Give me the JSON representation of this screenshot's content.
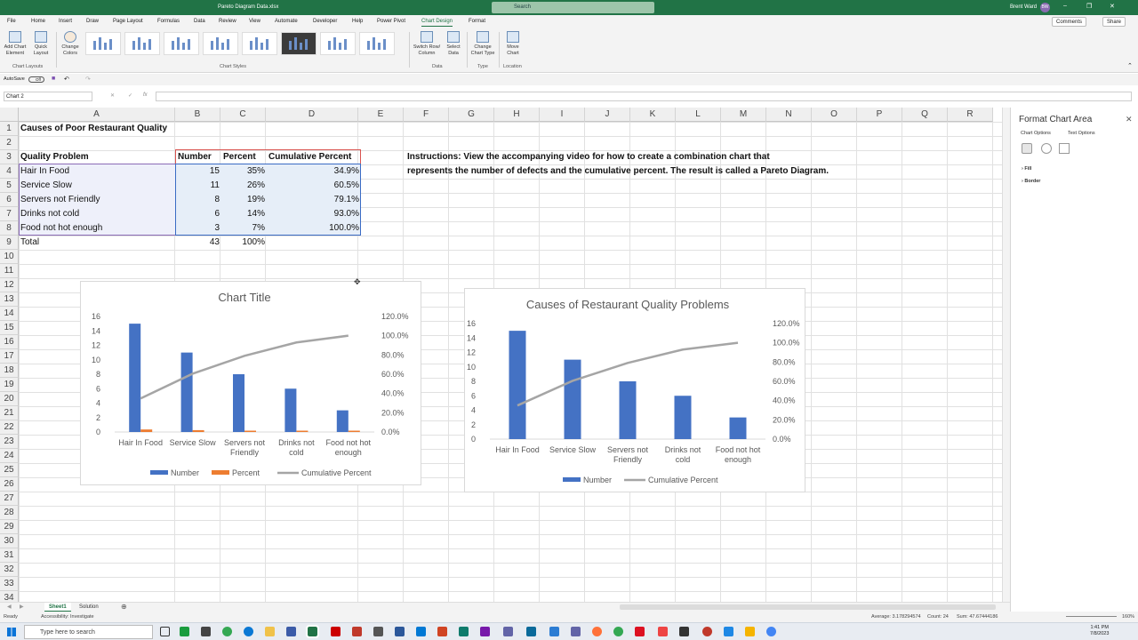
{
  "titlebar": {
    "file_title": "Pareto Diagram Data.xlsx",
    "search_placeholder": "Search",
    "user_name": "Brent Ward",
    "user_initials": "BW"
  },
  "menu_tabs": [
    "File",
    "Home",
    "Insert",
    "Draw",
    "Page Layout",
    "Formulas",
    "Data",
    "Review",
    "View",
    "Automate",
    "Developer",
    "Help",
    "Power Pivot",
    "Chart Design",
    "Format"
  ],
  "active_tab": "Chart Design",
  "comments_label": "Comments",
  "share_label": "Share",
  "ribbon": {
    "add_chart_element": "Add Chart Element",
    "quick_layout": "Quick Layout",
    "change_colors": "Change Colors",
    "switch_row_column": "Switch Row/ Column",
    "select_data": "Select Data",
    "change_chart_type": "Change Chart Type",
    "move_chart": "Move Chart",
    "groups": {
      "chart_layouts": "Chart Layouts",
      "chart_styles": "Chart Styles",
      "data": "Data",
      "type": "Type",
      "location": "Location"
    }
  },
  "qat": {
    "autosave": "AutoSave",
    "toggle": "Off"
  },
  "formula_bar": {
    "name_box": "Chart 2",
    "fx": "fx",
    "formula": ""
  },
  "columns": [
    "A",
    "B",
    "C",
    "D",
    "E",
    "F",
    "G",
    "H",
    "I",
    "J",
    "K",
    "L",
    "M",
    "N",
    "O",
    "P",
    "Q",
    "R"
  ],
  "rows": [
    "1",
    "2",
    "3",
    "4",
    "5",
    "6",
    "7",
    "8",
    "9",
    "10",
    "11",
    "12",
    "13",
    "14",
    "15",
    "16",
    "17",
    "18",
    "19",
    "20",
    "21",
    "22",
    "23",
    "24",
    "25",
    "26",
    "27",
    "28",
    "29",
    "30",
    "31",
    "32",
    "33",
    "34"
  ],
  "sheet": {
    "title": "Causes of Poor Restaurant Quality",
    "headers": [
      "Quality Problem",
      "Number",
      "Percent",
      "Cumulative Percent"
    ],
    "data_rows": [
      {
        "problem": "Hair In Food",
        "number": "15",
        "percent": "35%",
        "cumulative": "34.9%"
      },
      {
        "problem": "Service Slow",
        "number": "11",
        "percent": "26%",
        "cumulative": "60.5%"
      },
      {
        "problem": "Servers not Friendly",
        "number": "8",
        "percent": "19%",
        "cumulative": "79.1%"
      },
      {
        "problem": "Drinks not cold",
        "number": "6",
        "percent": "14%",
        "cumulative": "93.0%"
      },
      {
        "problem": "Food not hot enough",
        "number": "3",
        "percent": "7%",
        "cumulative": "100.0%"
      }
    ],
    "total": {
      "label": "Total",
      "number": "43",
      "percent": "100%"
    },
    "instructions_line1": "Instructions: View the accompanying video for how to create a combination chart that",
    "instructions_line2": "represents the number of defects and the cumulative percent.  The result is called a Pareto Diagram."
  },
  "chart_data": [
    {
      "type": "bar",
      "title": "Chart Title",
      "categories": [
        "Hair In Food",
        "Service Slow",
        "Servers not Friendly",
        "Drinks not cold",
        "Food not hot enough"
      ],
      "series": [
        {
          "name": "Number",
          "type": "bar",
          "axis": "primary",
          "color": "#4472c4",
          "values": [
            15,
            11,
            8,
            6,
            3
          ]
        },
        {
          "name": "Percent",
          "type": "bar",
          "axis": "primary",
          "color": "#ed7d31",
          "values": [
            0.349,
            0.256,
            0.186,
            0.14,
            0.07
          ]
        },
        {
          "name": "Cumulative Percent",
          "type": "line",
          "axis": "secondary",
          "color": "#a5a5a5",
          "values": [
            0.349,
            0.605,
            0.791,
            0.93,
            1.0
          ]
        }
      ],
      "y_ticks": [
        "0",
        "2",
        "4",
        "6",
        "8",
        "10",
        "12",
        "14",
        "16"
      ],
      "y2_ticks": [
        "0.0%",
        "20.0%",
        "40.0%",
        "60.0%",
        "80.0%",
        "100.0%",
        "120.0%"
      ],
      "ylim": [
        0,
        16
      ],
      "y2lim": [
        0,
        1.2
      ],
      "legend": "bottom",
      "grid": false
    },
    {
      "type": "bar",
      "title": "Causes of Restaurant Quality Problems",
      "categories": [
        "Hair In Food",
        "Service Slow",
        "Servers not Friendly",
        "Drinks not cold",
        "Food not hot enough"
      ],
      "series": [
        {
          "name": "Number",
          "type": "bar",
          "axis": "primary",
          "color": "#4472c4",
          "values": [
            15,
            11,
            8,
            6,
            3
          ]
        },
        {
          "name": "Cumulative Percent",
          "type": "line",
          "axis": "secondary",
          "color": "#a5a5a5",
          "values": [
            0.349,
            0.605,
            0.791,
            0.93,
            1.0
          ]
        }
      ],
      "y_ticks": [
        "0",
        "2",
        "4",
        "6",
        "8",
        "10",
        "12",
        "14",
        "16"
      ],
      "y2_ticks": [
        "0.0%",
        "20.0%",
        "40.0%",
        "60.0%",
        "80.0%",
        "100.0%",
        "120.0%"
      ],
      "ylim": [
        0,
        16
      ],
      "y2lim": [
        0,
        1.2
      ],
      "legend": "bottom",
      "grid": false
    }
  ],
  "sheet_tabs": [
    "Sheet1",
    "Solution"
  ],
  "status": {
    "ready": "Ready",
    "accessibility": "Accessibility: Investigate",
    "average": "Average: 3.178294574",
    "count": "Count: 24",
    "sum": "Sum: 47.67444186",
    "zoom": "160%"
  },
  "format_panel": {
    "title": "Format Chart Area",
    "chart_options": "Chart Options",
    "text_options": "Text Options",
    "fill": "Fill",
    "border": "Border"
  },
  "taskbar": {
    "search_placeholder": "Type here to search",
    "time": "1:41 PM",
    "date": "7/8/2023"
  }
}
